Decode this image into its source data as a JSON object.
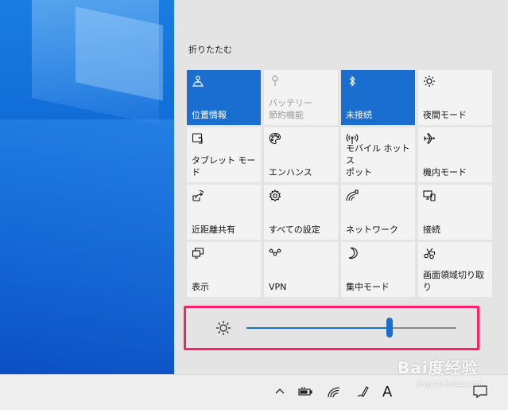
{
  "panel": {
    "collapse_label": "折りたたむ"
  },
  "tiles": [
    {
      "label": "位置情報",
      "icon": "location-icon",
      "state": "active"
    },
    {
      "label": "バッテリー\n節約機能",
      "icon": "battery-saver-icon",
      "state": "disabled"
    },
    {
      "label": "未接続",
      "icon": "bluetooth-icon",
      "state": "active"
    },
    {
      "label": "夜間モード",
      "icon": "night-light-icon",
      "state": "off"
    },
    {
      "label": "タブレット モード",
      "icon": "tablet-mode-icon",
      "state": "off"
    },
    {
      "label": "エンハンス",
      "icon": "palette-icon",
      "state": "off"
    },
    {
      "label": "モバイル ホットス\nポット",
      "icon": "hotspot-icon",
      "state": "off"
    },
    {
      "label": "機内モード",
      "icon": "airplane-icon",
      "state": "off"
    },
    {
      "label": "近距離共有",
      "icon": "nearby-share-icon",
      "state": "off"
    },
    {
      "label": "すべての設定",
      "icon": "gear-icon",
      "state": "off"
    },
    {
      "label": "ネットワーク",
      "icon": "network-icon",
      "state": "off"
    },
    {
      "label": "接続",
      "icon": "connect-icon",
      "state": "off"
    },
    {
      "label": "表示",
      "icon": "project-icon",
      "state": "off"
    },
    {
      "label": "VPN",
      "icon": "vpn-icon",
      "state": "off"
    },
    {
      "label": "集中モード",
      "icon": "moon-icon",
      "state": "off"
    },
    {
      "label": "画面領域切り取\nり",
      "icon": "snip-icon",
      "state": "off"
    }
  ],
  "brightness": {
    "level": 0.68
  },
  "taskbar": {
    "ime_label": "A"
  },
  "watermark": {
    "brand": "Bai度经验",
    "url": "jingyan.baidu.com"
  },
  "colors": {
    "accent": "#1a6ed0",
    "highlight_border": "#ff1f66"
  }
}
